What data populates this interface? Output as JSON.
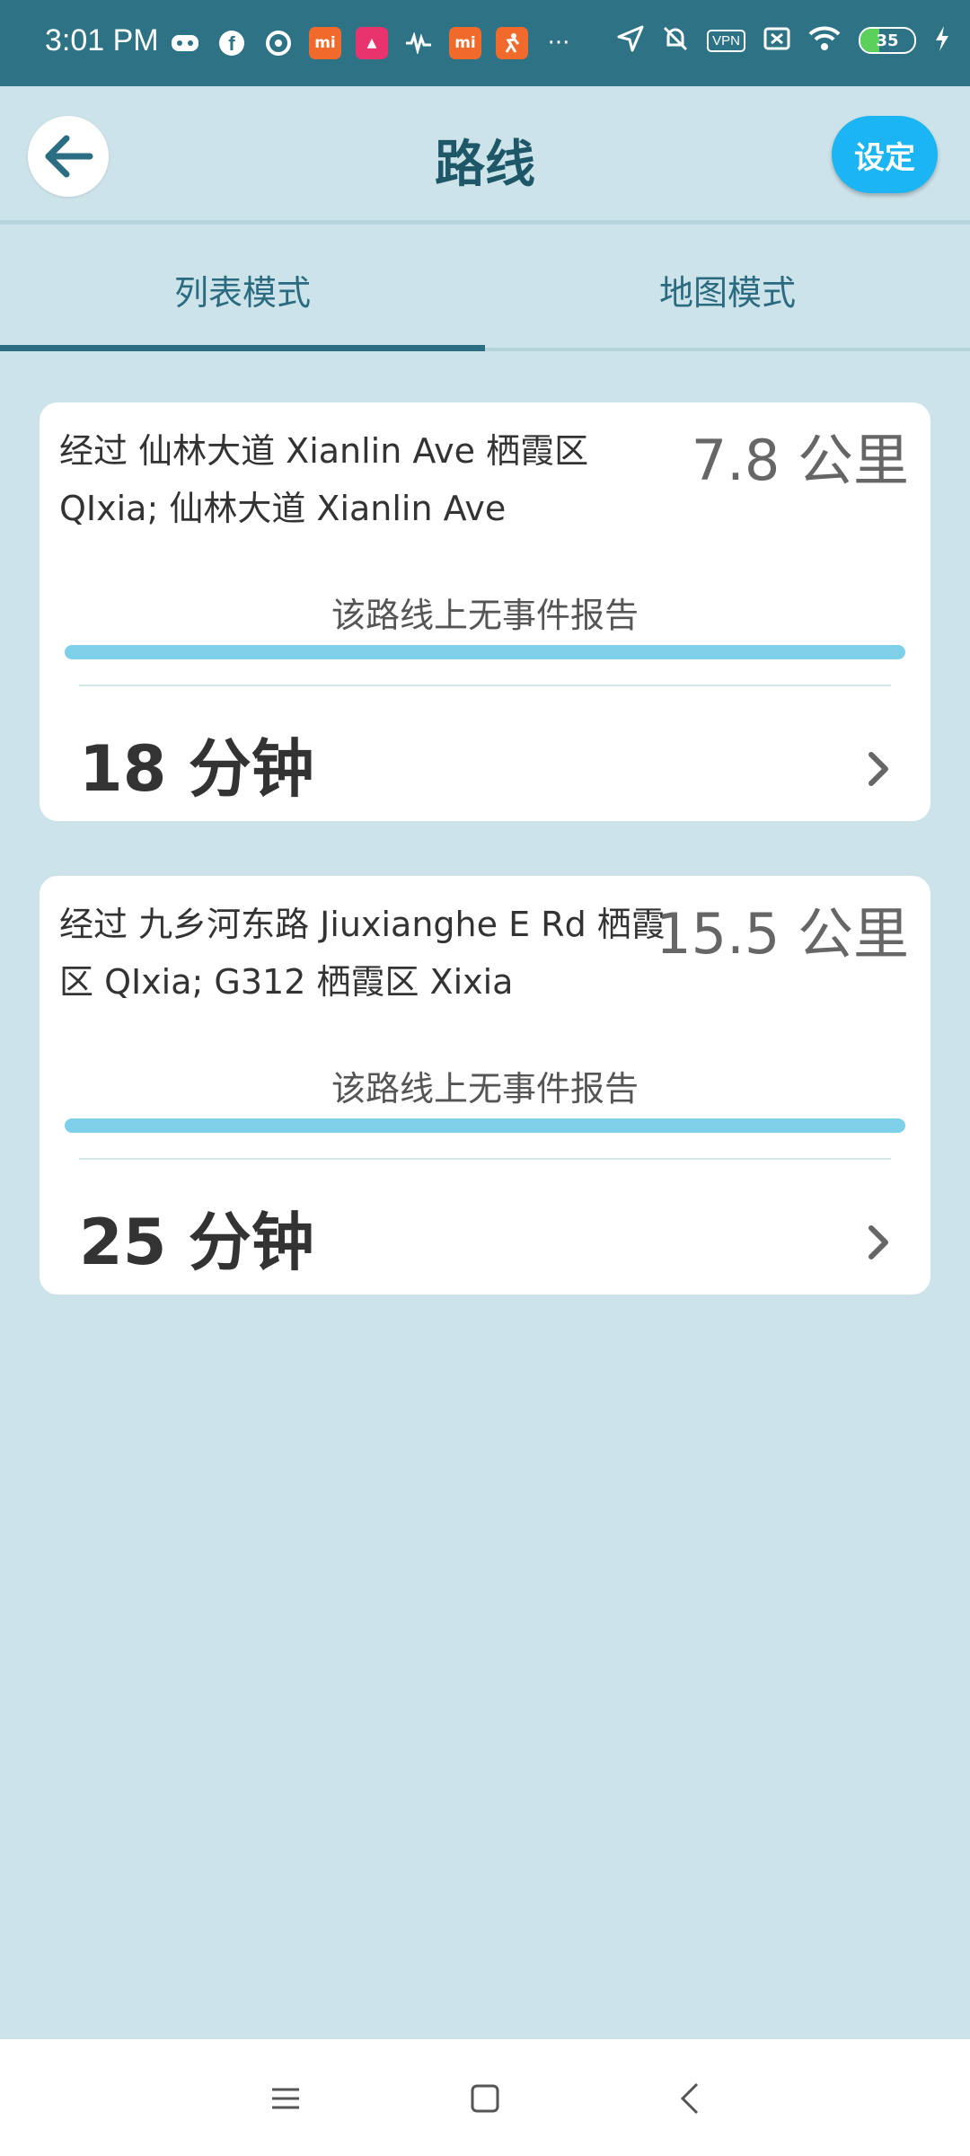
{
  "status_bar": {
    "time": "3:01 PM",
    "left_icons": [
      "game-controller-icon",
      "facebook-icon",
      "at-sign-icon",
      "mi-icon",
      "app-icon",
      "audio-wave-icon",
      "mi-icon",
      "runner-icon",
      "more-dots-icon"
    ],
    "vpn_label": "VPN",
    "battery_level": "35",
    "colors": {
      "background": "#2d7385",
      "battery_fill": "#5bd05b"
    }
  },
  "header": {
    "title": "路线",
    "settings_label": "设定",
    "colors": {
      "title": "#1e5868",
      "settings_bg": "#1ab5f2"
    }
  },
  "tabs": [
    {
      "label": "列表模式",
      "active": true
    },
    {
      "label": "地图模式",
      "active": false
    }
  ],
  "routes": [
    {
      "description": "经过 仙林大道 Xianlin Ave 栖霞区 QIxia; 仙林大道 Xianlin Ave",
      "distance": "7.8 公里",
      "incident_text": "该路线上无事件报告",
      "duration": "18 分钟"
    },
    {
      "description": "经过 九乡河东路 Jiuxianghe E Rd 栖霞区 QIxia; G312 栖霞区 Xixia",
      "distance": "15.5 公里",
      "incident_text": "该路线上无事件报告",
      "duration": "25 分钟"
    }
  ],
  "nav_bar": {
    "icons": [
      "menu-icon",
      "home-square-icon",
      "back-chevron-icon"
    ]
  },
  "theme": {
    "page_bg": "#cde3ea",
    "traffic_bar": "#7ed0e8"
  }
}
